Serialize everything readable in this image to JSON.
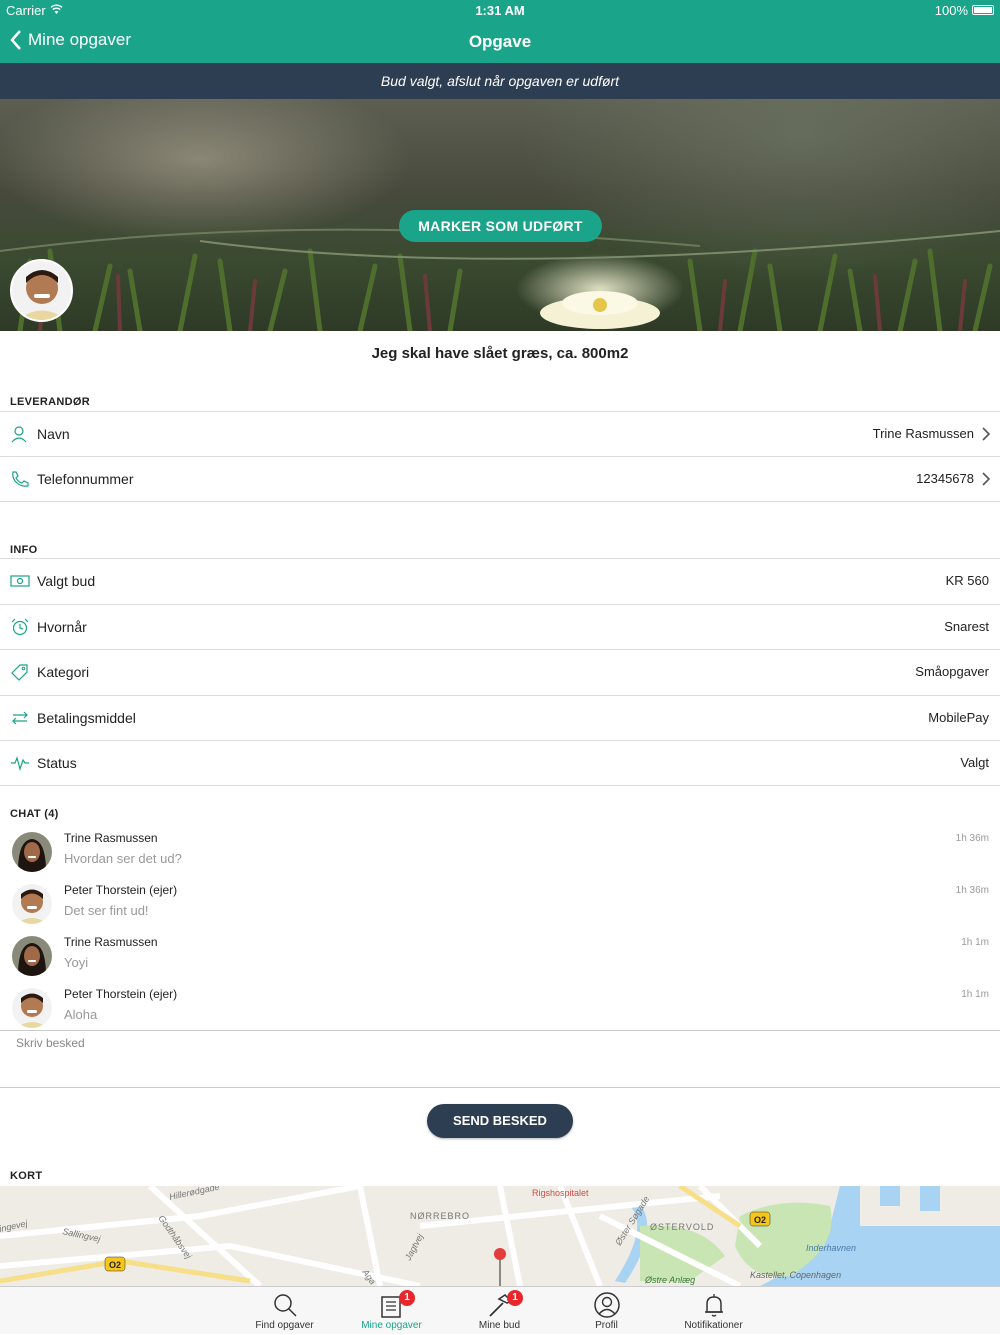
{
  "status_bar": {
    "carrier": "Carrier",
    "time": "1:31 AM",
    "battery": "100%"
  },
  "nav": {
    "back_label": "Mine opgaver",
    "title": "Opgave"
  },
  "banner": "Bud valgt, afslut når opgaven er udført",
  "hero": {
    "mark_done_label": "MARKER SOM UDFØRT"
  },
  "task_title": "Jeg skal have slået græs, ca. 800m2",
  "supplier": {
    "section_label": "LEVERANDØR",
    "rows": [
      {
        "icon": "person-icon",
        "label": "Navn",
        "value": "Trine Rasmussen"
      },
      {
        "icon": "phone-icon",
        "label": "Telefonnummer",
        "value": "12345678"
      }
    ]
  },
  "info": {
    "section_label": "INFO",
    "rows": [
      {
        "icon": "money-icon",
        "label": "Valgt bud",
        "value": "KR 560"
      },
      {
        "icon": "alarm-clock-icon",
        "label": "Hvornår",
        "value": "Snarest"
      },
      {
        "icon": "tag-icon",
        "label": "Kategori",
        "value": "Småopgaver"
      },
      {
        "icon": "transfer-arrows-icon",
        "label": "Betalingsmiddel",
        "value": "MobilePay"
      },
      {
        "icon": "pulse-icon",
        "label": "Status",
        "value": "Valgt"
      }
    ]
  },
  "chat": {
    "section_label": "CHAT (4)",
    "messages": [
      {
        "name": "Trine Rasmussen",
        "text": "Hvordan ser det ud?",
        "time": "1h 36m",
        "avatar": "woman"
      },
      {
        "name": "Peter Thorstein (ejer)",
        "text": "Det ser fint ud!",
        "time": "1h 36m",
        "avatar": "man"
      },
      {
        "name": "Trine Rasmussen",
        "text": "Yoyi",
        "time": "1h 1m",
        "avatar": "woman"
      },
      {
        "name": "Peter Thorstein (ejer)",
        "text": "Aloha",
        "time": "1h 1m",
        "avatar": "man"
      }
    ],
    "compose_placeholder": "Skriv besked",
    "send_label": "SEND BESKED"
  },
  "map": {
    "section_label": "KORT",
    "labels": [
      "Hillerødgade",
      "Godthåbsvej",
      "Sallingvej",
      "ingevej",
      "NØRREBRO",
      "Jagtvej",
      "Rigshospitalet",
      "Øster Søgade",
      "ØSTERVOLD",
      "Inderhavnen",
      "Kastellet, Copenhagen",
      "Østre Anlæg",
      "Aga"
    ],
    "route_badges": [
      "O2",
      "O2"
    ]
  },
  "tabs": [
    {
      "label": "Find opgaver",
      "icon": "search-icon",
      "badge": ""
    },
    {
      "label": "Mine opgaver",
      "icon": "list-icon",
      "badge": "1"
    },
    {
      "label": "Mine bud",
      "icon": "hammer-icon",
      "badge": "1"
    },
    {
      "label": "Profil",
      "icon": "profile-icon",
      "badge": ""
    },
    {
      "label": "Notifikationer",
      "icon": "bell-icon",
      "badge": ""
    }
  ],
  "colors": {
    "brand": "#1aa48a",
    "dark": "#2e3e52",
    "badge": "#e8262b"
  }
}
